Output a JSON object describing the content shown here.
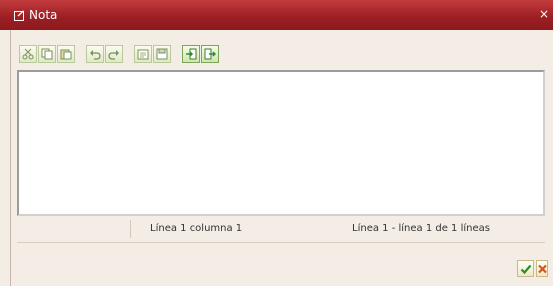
{
  "window": {
    "title": "Nota"
  },
  "toolbar": {
    "groups": [
      {
        "icons": [
          "cut-icon",
          "copy-icon",
          "paste-icon"
        ]
      },
      {
        "icons": [
          "undo-icon",
          "redo-icon"
        ]
      },
      {
        "icons": [
          "load-file-icon",
          "save-file-icon"
        ]
      },
      {
        "icons": [
          "import-icon",
          "export-icon"
        ]
      }
    ]
  },
  "editor": {
    "content": ""
  },
  "status": {
    "position": "Línea 1 columna 1",
    "lines": "Línea 1 - línea 1 de 1 líneas"
  },
  "footer": {
    "confirm_icon": "checkmark-icon",
    "cancel_icon": "close-icon"
  },
  "colors": {
    "titlebar": "#a0262a",
    "background": "#f3ede6",
    "confirm": "#2e8b2e",
    "cancel": "#d9531e"
  }
}
